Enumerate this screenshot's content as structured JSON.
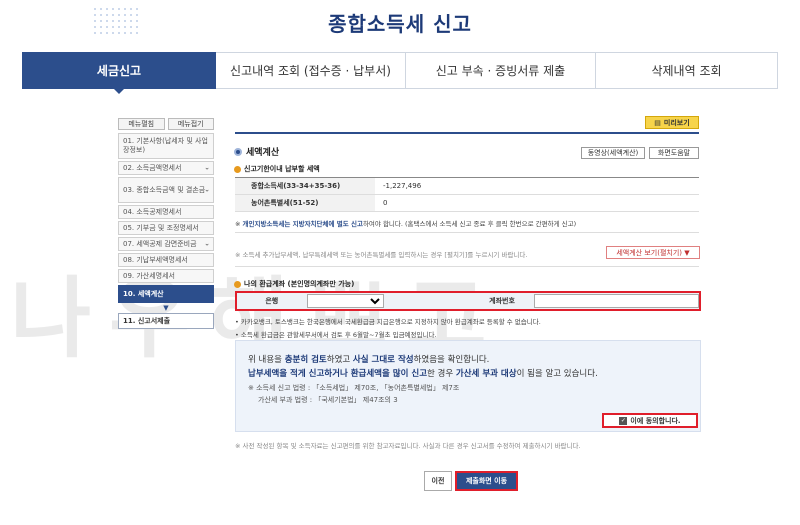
{
  "header": {
    "title": "종합소득세 신고"
  },
  "tabs": [
    {
      "label": "세금신고",
      "active": true
    },
    {
      "label": "신고내역 조회 (접수증 · 납부서)",
      "active": false
    },
    {
      "label": "신고 부속 · 증빙서류 제출",
      "active": false
    },
    {
      "label": "삭제내역 조회",
      "active": false
    }
  ],
  "sidebar": {
    "expand_label": "메뉴펼침",
    "collapse_label": "메뉴접기",
    "items": [
      {
        "label": "01. 기본사항(납세자 및 사업장정보)"
      },
      {
        "label": "02. 소득금액명세서"
      },
      {
        "label": "03. 종합소득금액 및 결손금"
      },
      {
        "label": "04. 소득공제명세서"
      },
      {
        "label": "05. 기부금 및 조정명세서"
      },
      {
        "label": "07. 세액공제 감면준비금"
      },
      {
        "label": "08. 기납부세액명세서"
      },
      {
        "label": "09. 가산세명세서"
      },
      {
        "label": "10. 세액계산"
      },
      {
        "label": "11. 신고서제출"
      }
    ]
  },
  "toolbar": {
    "preview_label": "미리보기"
  },
  "section": {
    "title": "세액계산",
    "video_btn": "동영상(세액계산)",
    "help_btn": "화면도움말",
    "sub_title": "신고기한이내 납부할 세액",
    "rows": [
      {
        "label": "종합소득세(33-34+35-36)",
        "value": "-1,227,496"
      },
      {
        "label": "농어촌특별세(51-52)",
        "value": "0"
      }
    ],
    "note1_prefix": "※ ",
    "note1_blue": "개인지방소득세는 지방자치단체에 별도 신고",
    "note1_rest": "하여야 합니다. (홈택스에서 소득세 신고 종료 후 클릭 한번으로 간편하게 신고)",
    "note2": "※ 소득세 추가납부세액, 납부특례세액 또는 농어촌특별세를 입력하시는 경우 [펼치기]를 누르시기 바랍니다.",
    "detail_btn": "세액계산 보기(펼치기) ▼"
  },
  "refund": {
    "title": "나의 환급계좌 (본인명의계좌만 가능)",
    "bank_label": "은행",
    "bank_value": "",
    "account_label": "계좌번호",
    "account_value": "",
    "note1": "• 카카오뱅크, 토스뱅크는 한국은행에서 국세환급금 지급은행으로 지정하지 않아 환급계좌로 등록할 수 없습니다.",
    "note2": "• 소득세 환급금은 관할세무서에서 검토 후 6월말~7월초 입금예정입니다."
  },
  "notice": {
    "line1_a": "위 내용을 ",
    "line1_b": "충분히 검토",
    "line1_c": "하였고 ",
    "line1_d": "사실 그대로 작성",
    "line1_e": "하였음을 확인합니다.",
    "line2_a": "납부세액을 적게 신고하거나 환급세액을 많이 신고",
    "line2_b": "한 경우 ",
    "line2_c": "가산세 부과 대상",
    "line2_d": "이 됨을 알고 있습니다.",
    "law1": "※ 소득세 신고 법령 : 「소득세법」 제70조, 「농어촌특별세법」 제7조",
    "law2": "가산세 부과 법령 : 「국세기본법」 제47조의 3",
    "agree_label": "이에 동의합니다."
  },
  "footer_note": "※ 사전 작성된 항목 및 소득자료는 신고편의를 위한 참고자료입니다. 사실과 다른 경우 신고서를 수정하여 제출하시기 바랍니다.",
  "buttons": {
    "prev": "이전",
    "submit": "제출화면 이동"
  },
  "watermark": "나우해쁘고"
}
